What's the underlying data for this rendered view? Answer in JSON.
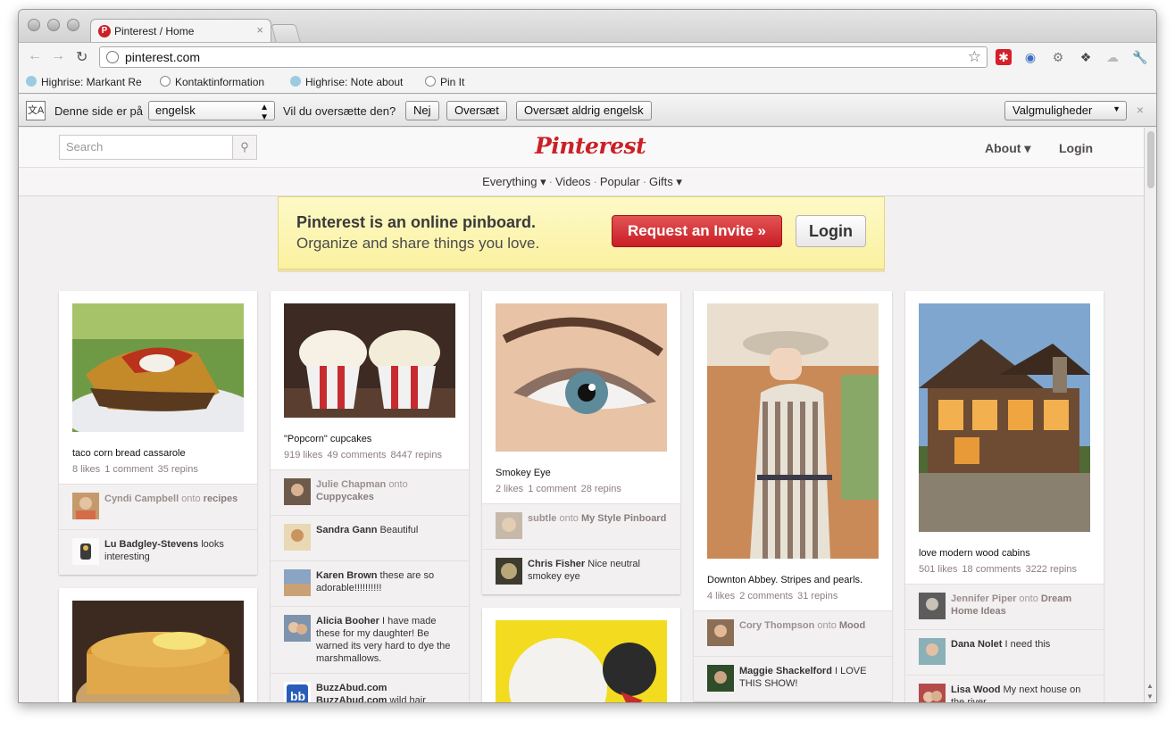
{
  "browser": {
    "tab_title": "Pinterest / Home",
    "tab_close": "×",
    "url": "pinterest.com",
    "bookmarks": [
      "Highrise: Markant Re",
      "Kontaktinformation",
      "Highrise: Note about",
      "Pin It"
    ],
    "star_icon": "☆",
    "extension_icons": [
      "lastpass-icon",
      "translate-ext-icon",
      "gear-ext-icon",
      "pin-ext-icon",
      "chat-ext-icon",
      "wrench-icon"
    ]
  },
  "translate_bar": {
    "prefix": "Denne side er på",
    "language": "engelsk",
    "question": "Vil du oversætte den?",
    "btn_no": "Nej",
    "btn_translate": "Oversæt",
    "btn_never": "Oversæt aldrig engelsk",
    "options": "Valgmuligheder",
    "close": "×"
  },
  "header": {
    "search_placeholder": "Search",
    "logo": "Pinterest",
    "about": "About ▾",
    "login": "Login"
  },
  "subnav": {
    "everything": "Everything ▾",
    "videos": "Videos",
    "popular": "Popular",
    "gifts": "Gifts ▾",
    "sep": "·"
  },
  "banner": {
    "title": "Pinterest is an online pinboard.",
    "subtitle": "Organize and share things you love.",
    "invite": "Request an Invite »",
    "login": "Login"
  },
  "pins": [
    {
      "desc": "taco corn bread cassarole",
      "likes": "8 likes",
      "comments": "1 comment",
      "repins": "35 repins",
      "c1_user": "Cyndi Campbell",
      "c1_onto": "onto",
      "c1_board": "recipes",
      "c2_user": "Lu Badgley-Stevens",
      "c2_text": "looks interesting"
    },
    {
      "desc": "\"Popcorn\" cupcakes",
      "likes": "919 likes",
      "comments": "49 comments",
      "repins": "8447 repins",
      "c1_user": "Julie Chapman",
      "c1_onto": "onto",
      "c1_board": "Cuppycakes",
      "c2_user": "Sandra Gann",
      "c2_text": "Beautiful",
      "c3_user": "Karen Brown",
      "c3_text": "these are so adorable!!!!!!!!!!",
      "c4_user": "Alicia Booher",
      "c4_text": "I have made these for my daughter! Be warned its very hard to dye the marshmallows.",
      "c5_user": "BuzzAbud.com BuzzAbud.com",
      "c5_text": "wild hair"
    },
    {
      "desc": "Smokey Eye",
      "likes": "2 likes",
      "comments": "1 comment",
      "repins": "28 repins",
      "c1_user": "subtle",
      "c1_onto": "onto",
      "c1_board": "My Style Pinboard",
      "c2_user": "Chris Fisher",
      "c2_text": "Nice neutral smokey eye"
    },
    {
      "desc": "Downton Abbey. Stripes and pearls.",
      "likes": "4 likes",
      "comments": "2 comments",
      "repins": "31 repins",
      "c1_user": "Cory Thompson",
      "c1_onto": "onto",
      "c1_board": "Mood",
      "c2_user": "Maggie Shackelford",
      "c2_text": "I LOVE THIS SHOW!"
    },
    {
      "desc": "love modern wood cabins",
      "likes": "501 likes",
      "comments": "18 comments",
      "repins": "3222 repins",
      "c1_user": "Jennifer Piper",
      "c1_onto": "onto",
      "c1_board": "Dream Home Ideas",
      "c2_user": "Dana Nolet",
      "c2_text": "I need this",
      "c3_user": "Lisa Wood",
      "c3_text": "My next house on the river."
    }
  ]
}
